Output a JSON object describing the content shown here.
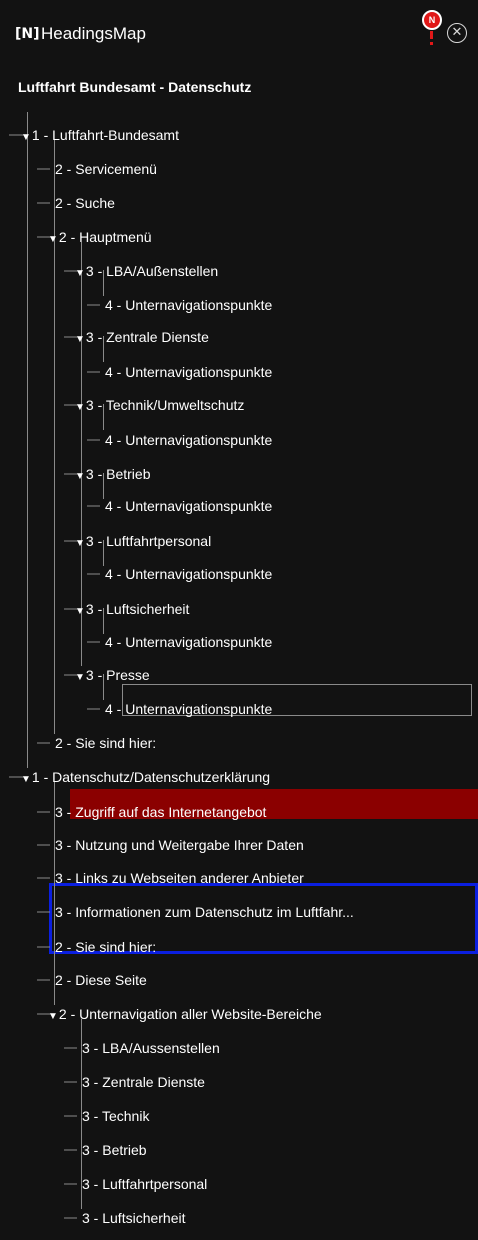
{
  "header": {
    "logo_text": "[N]",
    "app_title": "HeadingsMap",
    "notification_badge": "N",
    "close_symbol": "✕"
  },
  "page_title": "Luftfahrt Bundesamt - Datenschutz",
  "tree": [
    {
      "text": "1 - Luftfahrt-Bundesamt",
      "expanded": true
    },
    {
      "text": "2 - Servicemenü"
    },
    {
      "text": "2 - Suche"
    },
    {
      "text": "2 - Hauptmenü",
      "expanded": true
    },
    {
      "text": "3 - LBA/Außenstellen",
      "expanded": true
    },
    {
      "text": "4 - Unternavigationspunkte"
    },
    {
      "text": "3 - Zentrale Dienste",
      "expanded": true
    },
    {
      "text": "4 - Unternavigationspunkte"
    },
    {
      "text": "3 - Technik/Umweltschutz",
      "expanded": true
    },
    {
      "text": "4 - Unternavigationspunkte"
    },
    {
      "text": "3 - Betrieb",
      "expanded": true
    },
    {
      "text": "4 - Unternavigationspunkte"
    },
    {
      "text": "3 - Luftfahrtpersonal",
      "expanded": true
    },
    {
      "text": "4 - Unternavigationspunkte"
    },
    {
      "text": "3 - Luftsicherheit",
      "expanded": true
    },
    {
      "text": "4 - Unternavigationspunkte"
    },
    {
      "text": "3 - Presse",
      "expanded": true
    },
    {
      "text": "4 - Unternavigationspunkte",
      "state": "focused"
    },
    {
      "text": "2 - Sie sind hier:"
    },
    {
      "text": "1 - Datenschutz/Datenschutzerklärung",
      "expanded": true
    },
    {
      "text": "3 - Zugriff auf das Internetangebot",
      "state": "selected"
    },
    {
      "text": "3 - Nutzung und Weitergabe Ihrer Daten"
    },
    {
      "text": "3 - Links zu Webseiten anderer Anbieter"
    },
    {
      "text": "3 - Informationen zum Datenschutz im Luftfahr...",
      "state": "highlighted"
    },
    {
      "text": "2 - Sie sind hier:",
      "state": "highlighted"
    },
    {
      "text": "2 - Diese Seite"
    },
    {
      "text": "2 - Unternavigation aller Website-Bereiche",
      "expanded": true
    },
    {
      "text": "3 - LBA/Aussenstellen"
    },
    {
      "text": "3 - Zentrale Dienste"
    },
    {
      "text": "3 - Technik"
    },
    {
      "text": "3 - Betrieb"
    },
    {
      "text": "3 - Luftfahrtpersonal"
    },
    {
      "text": "3 - Luftsicherheit"
    }
  ],
  "colors": {
    "background": "#121212",
    "text": "#ffffff",
    "selected_bg": "#8b0000",
    "highlight_outline": "#0b1fe0",
    "focus_outline": "#8a8a8a",
    "tree_lines": "#8a8a8a",
    "notification": "#e11818"
  }
}
